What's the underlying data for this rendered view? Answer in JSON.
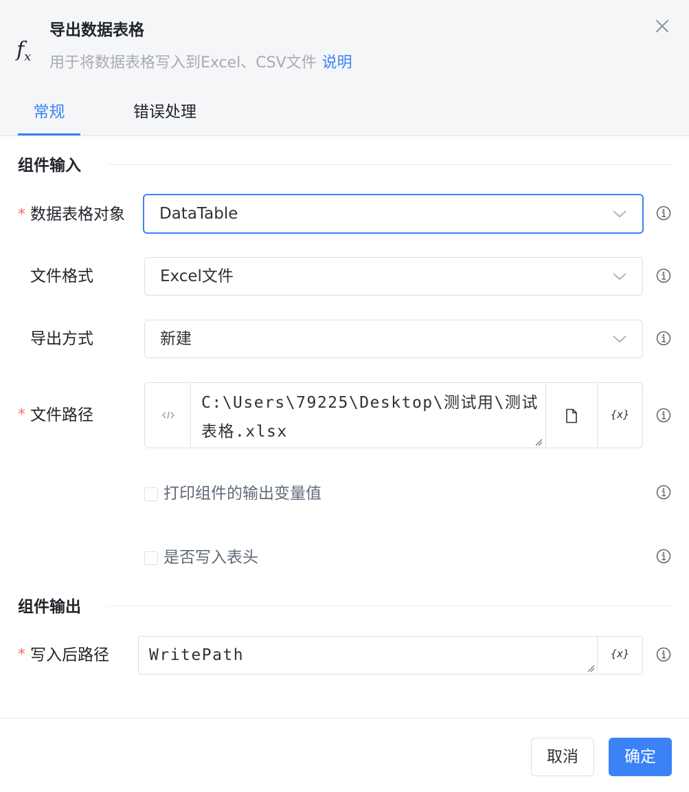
{
  "header": {
    "title": "导出数据表格",
    "subtitle": "用于将数据表格写入到Excel、CSV文件",
    "help_link": "说明",
    "icon": "fx-icon"
  },
  "tabs": [
    {
      "label": "常规",
      "active": true
    },
    {
      "label": "错误处理",
      "active": false
    }
  ],
  "input_section": {
    "title": "组件输入",
    "fields": {
      "datatable": {
        "label": "数据表格对象",
        "required": true,
        "value": "DataTable"
      },
      "format": {
        "label": "文件格式",
        "required": false,
        "value": "Excel文件"
      },
      "mode": {
        "label": "导出方式",
        "required": false,
        "value": "新建"
      },
      "path": {
        "label": "文件路径",
        "required": true,
        "value": "C:\\Users\\79225\\Desktop\\测试用\\测试表格.xlsx"
      }
    },
    "checkboxes": {
      "print_output": {
        "label": "打印组件的输出变量值",
        "checked": false
      },
      "write_header": {
        "label": "是否写入表头",
        "checked": false
      }
    }
  },
  "output_section": {
    "title": "组件输出",
    "fields": {
      "write_path": {
        "label": "写入后路径",
        "required": true,
        "value": "WritePath"
      }
    }
  },
  "variable_button_label": "{x}",
  "required_marker": "*",
  "footer": {
    "cancel_label": "取消",
    "ok_label": "确定"
  },
  "colors": {
    "accent": "#3b82f6",
    "required": "#f56c6c",
    "header_bg": "#f5f6f7",
    "border": "#dcdfe6"
  }
}
